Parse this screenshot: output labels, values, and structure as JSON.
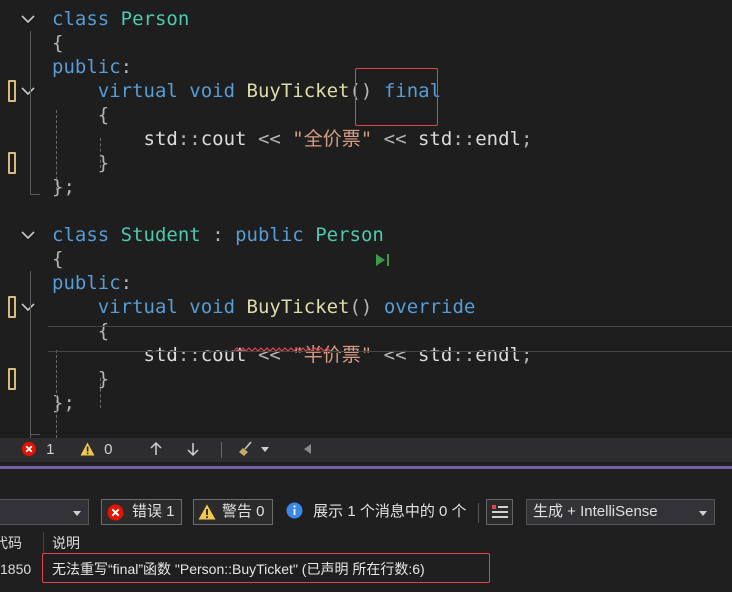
{
  "editor": {
    "lines": [
      {
        "tokens": [
          [
            "kw",
            "class"
          ],
          [
            "id",
            " "
          ],
          [
            "ty",
            "Person"
          ]
        ]
      },
      {
        "tokens": [
          [
            "pu",
            "{"
          ]
        ]
      },
      {
        "tokens": [
          [
            "kw",
            "public"
          ],
          [
            "pu",
            ":"
          ]
        ]
      },
      {
        "tokens": [
          [
            "id",
            "    "
          ],
          [
            "kw",
            "virtual"
          ],
          [
            "id",
            " "
          ],
          [
            "kw",
            "void"
          ],
          [
            "id",
            " "
          ],
          [
            "fn",
            "BuyTicket"
          ],
          [
            "pu",
            "()"
          ],
          [
            "id",
            " "
          ],
          [
            "kw",
            "final"
          ]
        ]
      },
      {
        "tokens": [
          [
            "id",
            "    "
          ],
          [
            "pu",
            "{"
          ]
        ]
      },
      {
        "tokens": [
          [
            "id",
            "        "
          ],
          [
            "id",
            "std"
          ],
          [
            "pu",
            "::"
          ],
          [
            "id",
            "cout"
          ],
          [
            "id",
            " "
          ],
          [
            "pu",
            "<<"
          ],
          [
            "id",
            " "
          ],
          [
            "str",
            "\"全价票\""
          ],
          [
            "id",
            " "
          ],
          [
            "pu",
            "<<"
          ],
          [
            "id",
            " "
          ],
          [
            "id",
            "std"
          ],
          [
            "pu",
            "::"
          ],
          [
            "id",
            "endl"
          ],
          [
            "pu",
            ";"
          ]
        ]
      },
      {
        "tokens": [
          [
            "id",
            "    "
          ],
          [
            "pu",
            "}"
          ]
        ]
      },
      {
        "tokens": [
          [
            "pu",
            "};"
          ]
        ]
      },
      {
        "tokens": []
      },
      {
        "tokens": [
          [
            "kw",
            "class"
          ],
          [
            "id",
            " "
          ],
          [
            "ty",
            "Student"
          ],
          [
            "id",
            " "
          ],
          [
            "pu",
            ":"
          ],
          [
            "id",
            " "
          ],
          [
            "kw",
            "public"
          ],
          [
            "id",
            " "
          ],
          [
            "ty",
            "Person"
          ]
        ]
      },
      {
        "tokens": [
          [
            "pu",
            "{"
          ]
        ]
      },
      {
        "tokens": [
          [
            "kw",
            "public"
          ],
          [
            "pu",
            ":"
          ]
        ]
      },
      {
        "tokens": [
          [
            "id",
            "    "
          ],
          [
            "kw",
            "virtual"
          ],
          [
            "id",
            " "
          ],
          [
            "kw",
            "void"
          ],
          [
            "id",
            " "
          ],
          [
            "fn",
            "BuyTicket"
          ],
          [
            "pu",
            "()"
          ],
          [
            "id",
            " "
          ],
          [
            "kw",
            "override"
          ]
        ]
      },
      {
        "tokens": [
          [
            "id",
            "    "
          ],
          [
            "pu",
            "{"
          ]
        ]
      },
      {
        "tokens": [
          [
            "id",
            "        "
          ],
          [
            "id",
            "std"
          ],
          [
            "pu",
            "::"
          ],
          [
            "id",
            "cout"
          ],
          [
            "id",
            " "
          ],
          [
            "pu",
            "<<"
          ],
          [
            "id",
            " "
          ],
          [
            "str",
            "\"半价票\""
          ],
          [
            "id",
            " "
          ],
          [
            "pu",
            "<<"
          ],
          [
            "id",
            " "
          ],
          [
            "id",
            "std"
          ],
          [
            "pu",
            "::"
          ],
          [
            "id",
            "endl"
          ],
          [
            "pu",
            ";"
          ]
        ]
      },
      {
        "tokens": [
          [
            "id",
            "    "
          ],
          [
            "pu",
            "}"
          ]
        ]
      },
      {
        "tokens": [
          [
            "pu",
            "};"
          ]
        ]
      }
    ]
  },
  "status_bar": {
    "errors": "1",
    "warnings": "0"
  },
  "error_list": {
    "errors_label": "错误 1",
    "warnings_label": "警告 0",
    "messages_label": "展示 1 个消息中的 0 个",
    "source_value": "生成 + IntelliSense",
    "col_code": "代码",
    "col_desc": "说明",
    "row_code": "1850",
    "row_desc": "无法重写“final”函数 \"Person::BuyTicket\" (已声明 所在行数:6)"
  },
  "colors": {
    "accent_red": "#e0444c",
    "change_marker": "#d7ba7d",
    "panel_separator": "#7061a8"
  }
}
